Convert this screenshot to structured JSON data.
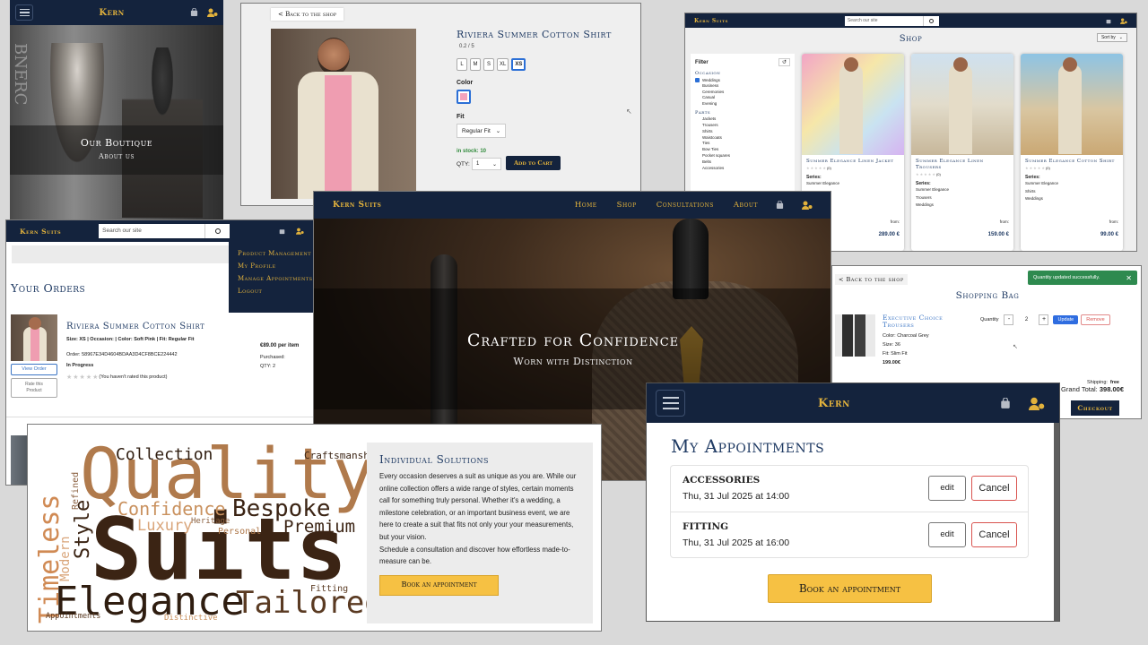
{
  "brand": "Kern",
  "brand_suits": "Kern Suits",
  "icons": {
    "menu": "menu-icon",
    "bag": "shopping-bag-icon",
    "user": "user-gear-icon",
    "search": "search-icon",
    "reset": "reset-icon",
    "close": "close-icon"
  },
  "colors": {
    "navy": "#14233d",
    "gold": "#e2b23c",
    "button_gold": "#f6c143",
    "page_bg": "#d9d9d9"
  },
  "boutique": {
    "title": "Our Boutique",
    "subtitle": "About us",
    "sign_letters": "BNERC"
  },
  "product": {
    "back_label": "< Back to the shop",
    "name": "Riviera Summer Cotton Shirt",
    "rating": "0.2 / 5",
    "sizes": [
      "L",
      "M",
      "S",
      "XL",
      "XS"
    ],
    "selected_size": "XS",
    "color_label": "Color",
    "color_swatch": "#f4a3bd",
    "fit_label": "Fit",
    "fit_value": "Regular Fit",
    "stock": "in stock: 10",
    "qty_label": "QTY:",
    "qty_value": "1",
    "add_to_cart": "Add to Cart"
  },
  "shop": {
    "brand": "Kern Suits",
    "search_placeholder": "Search our site",
    "title": "Shop",
    "sort_label": "Sort by",
    "filter_title": "Filter",
    "occasion_title": "Occasion",
    "occasions": [
      "Weddings",
      "Business",
      "Ceremonies",
      "Casual",
      "Evening"
    ],
    "checked_occasion": "Weddings",
    "parts_title": "Parts",
    "parts": [
      "Jackets",
      "Trousers",
      "Shirts",
      "Waistcoats",
      "Ties",
      "Bow Ties",
      "Pocket squares",
      "Belts",
      "Accessories"
    ],
    "products": [
      {
        "name": "Summer Elegance Linen Jacket",
        "rating": "(0)",
        "series_label": "Series:",
        "series": "Summer Elegance",
        "tags": [],
        "from": "from:",
        "price": "289.00 €"
      },
      {
        "name": "Summer Elegance Linen Trousers",
        "rating": "(0)",
        "series_label": "Series:",
        "series": "Summer Elegance",
        "tags": [
          "Trousers",
          "Weddings"
        ],
        "from": "from:",
        "price": "159.00 €"
      },
      {
        "name": "Summer Elegance Cotton Shirt",
        "rating": "(0)",
        "series_label": "Series:",
        "series": "Summer Elegance",
        "tags": [
          "Shirts",
          "Weddings"
        ],
        "from": "from:",
        "price": "99.00 €"
      }
    ]
  },
  "orders": {
    "brand": "Kern Suits",
    "search_placeholder": "Search our site",
    "dropdown": [
      "Product Management",
      "My Profile",
      "Manage Appointments",
      "Logout"
    ],
    "title": "Your Orders",
    "item_name": "Riviera Summer Cotton Shirt",
    "item_details": "Size: XS | Occasion: | Color: Soft Pink | Fit: Regular Fit",
    "order_id": "Order: 58967E34D4604BDAA3D4CF8BCE224442",
    "status": "In Progress",
    "price": "€89.00 per item",
    "purchased": "Purchased:",
    "qty": "QTY: 2",
    "view_order": "View Order",
    "rate": "Rate this Product",
    "not_rated": "(You haven't rated this product)"
  },
  "hero": {
    "brand": "Kern Suits",
    "nav": [
      "Home",
      "Shop",
      "Consultations",
      "About"
    ],
    "headline": "Crafted for Confidence",
    "subline": "Worn with Distinction"
  },
  "bag": {
    "back_label": "< Back to the shop",
    "toast": "Quantity updated successfully.",
    "title": "Shopping Bag",
    "item_name": "Executive Choice Trousers",
    "color": "Color: Charcoal Grey",
    "size": "Size: 36",
    "fit": "Fit: Slim Fit",
    "price": "199.00€",
    "qty_label": "Quantity",
    "qty": "2",
    "minus": "-",
    "plus": "+",
    "update": "Update",
    "remove": "Remove",
    "shipping_label": "Shipping:",
    "shipping_value": "free",
    "total_label": "Grand Total:",
    "total_value": "398.00€",
    "checkout": "Checkout"
  },
  "wordcloud": {
    "words": [
      {
        "text": "Quality",
        "color": "#b07a4c"
      },
      {
        "text": "Suits",
        "color": "#3b2414"
      },
      {
        "text": "Elegance",
        "color": "#2f1d10"
      },
      {
        "text": "Tailored",
        "color": "#5a3a22"
      },
      {
        "text": "Bespoke",
        "color": "#3b2414"
      },
      {
        "text": "Confidence",
        "color": "#c9915e"
      },
      {
        "text": "Collection",
        "color": "#2f1d10"
      },
      {
        "text": "Premium",
        "color": "#3b2414"
      },
      {
        "text": "Luxury",
        "color": "#d9a57a"
      },
      {
        "text": "Style",
        "color": "#3b2414"
      },
      {
        "text": "Timeless",
        "color": "#d08a54"
      },
      {
        "text": "Modern",
        "color": "#d9a57a"
      },
      {
        "text": "Refined",
        "color": "#8a6040"
      },
      {
        "text": "Craftsmanship",
        "color": "#3b2414"
      },
      {
        "text": "Heritage",
        "color": "#8a6040"
      },
      {
        "text": "Personal",
        "color": "#b07a4c"
      },
      {
        "text": "Fitting",
        "color": "#5a3a22"
      },
      {
        "text": "Appointments",
        "color": "#5a3a22"
      },
      {
        "text": "Distinctive",
        "color": "#c9915e"
      }
    ],
    "panel_title": "Individual Solutions",
    "panel_text": "Every occasion deserves a suit as unique as you are. While our online collection offers a wide range of styles, certain moments call for something truly personal. Whether it's a wedding, a milestone celebration, or an important business event, we are here to create a suit that fits not only your your measurements, but your vision.",
    "panel_text2": "Schedule a consultation and discover how effortless made-to-measure can be.",
    "button": "Book an appointment"
  },
  "appointments": {
    "brand": "Kern",
    "title": "My Appointments",
    "items": [
      {
        "type": "ACCESSORIES",
        "date": "Thu, 31 Jul 2025 at 14:00",
        "edit": "edit",
        "cancel": "Cancel"
      },
      {
        "type": "FITTING",
        "date": "Thu, 31 Jul 2025 at 16:00",
        "edit": "edit",
        "cancel": "Cancel"
      }
    ],
    "button": "Book an appointment"
  }
}
